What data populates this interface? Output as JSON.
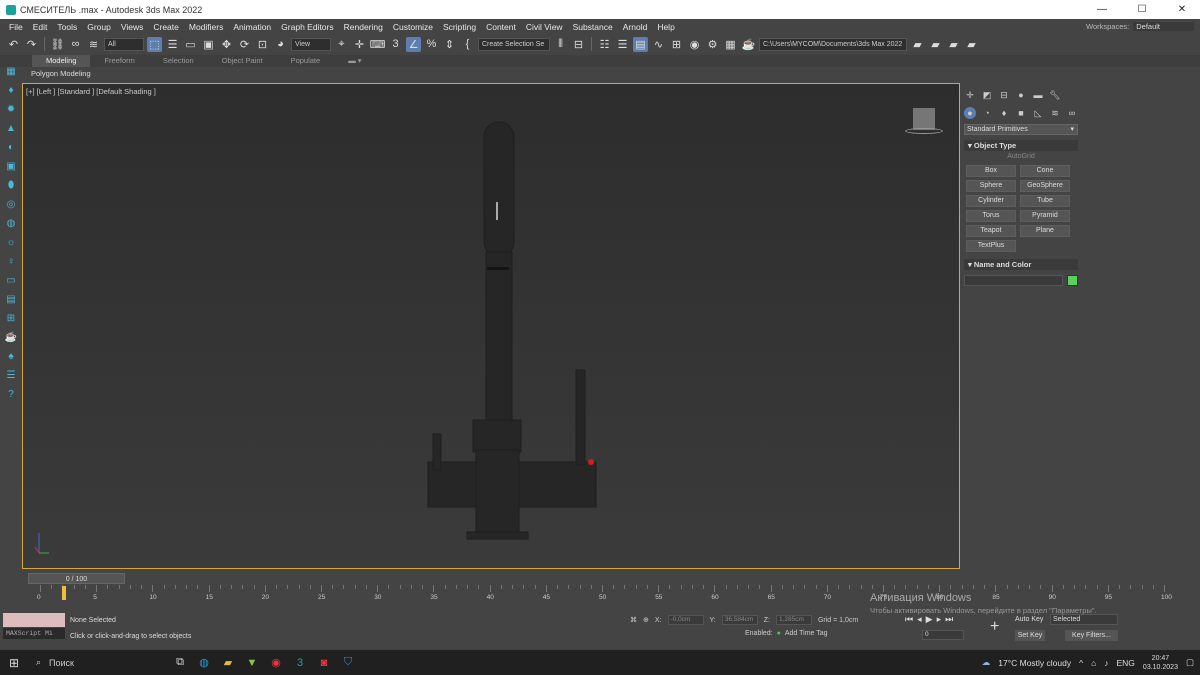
{
  "window": {
    "title": "СМЕСИТЕЛЬ .max - Autodesk 3ds Max 2022",
    "minimize": "—",
    "maximize": "☐",
    "close": "✕"
  },
  "menu": [
    "File",
    "Edit",
    "Tools",
    "Group",
    "Views",
    "Create",
    "Modifiers",
    "Animation",
    "Graph Editors",
    "Rendering",
    "Customize",
    "Scripting",
    "Content",
    "Civil View",
    "Substance",
    "Arnold",
    "Help"
  ],
  "workspaces": {
    "label": "Workspaces:",
    "value": "Default"
  },
  "toolbar": {
    "filter": "All",
    "ref_coord": "View",
    "selection_set": "Create Selection Se",
    "path": "C:\\Users\\MYCOM\\Documents\\3ds Max 2022"
  },
  "ribbon": {
    "tabs": [
      "Modeling",
      "Freeform",
      "Selection",
      "Object Paint",
      "Populate"
    ],
    "active": "Modeling",
    "panel": "Polygon Modeling"
  },
  "viewport": {
    "label": "[+] [Left ] [Standard ] [Default Shading ]"
  },
  "command_panel": {
    "dropdown": "Standard Primitives",
    "object_type_title": "Object Type",
    "autogrid": "AutoGrid",
    "buttons": [
      "Box",
      "Cone",
      "Sphere",
      "GeoSphere",
      "Cylinder",
      "Tube",
      "Torus",
      "Pyramid",
      "Teapot",
      "Plane",
      "TextPlus"
    ],
    "name_color_title": "Name and Color",
    "color": "#5ad15a"
  },
  "timeline": {
    "slider": "0 / 100",
    "ticks": [
      "0",
      "5",
      "10",
      "15",
      "20",
      "25",
      "30",
      "35",
      "40",
      "45",
      "50",
      "55",
      "60",
      "65",
      "70",
      "75",
      "80",
      "85",
      "90",
      "95",
      "100"
    ]
  },
  "status": {
    "maxscript": "MAXScript Mi",
    "selection": "None Selected",
    "prompt": "Click or click-and-drag to select objects",
    "x_label": "X:",
    "x": "-0,0cm",
    "y_label": "Y:",
    "y": "36,584cm",
    "z_label": "Z:",
    "z": "1,285cm",
    "grid": "Grid = 1,0cm",
    "enabled": "Enabled:",
    "add_time_tag": "Add Time Tag"
  },
  "anim": {
    "auto_key": "Auto Key",
    "selected": "Selected",
    "set_key": "Set Key",
    "key_filters": "Key Filters...",
    "frame": "0"
  },
  "watermark": {
    "line1": "Активация Windows",
    "line2": "Чтобы активировать Windows, перейдите в раздел \"Параметры\"."
  },
  "taskbar": {
    "search": "Поиск",
    "weather": "17°C  Mostly cloudy",
    "lang": "ENG",
    "time": "20:47",
    "date": "03.10.2023"
  }
}
